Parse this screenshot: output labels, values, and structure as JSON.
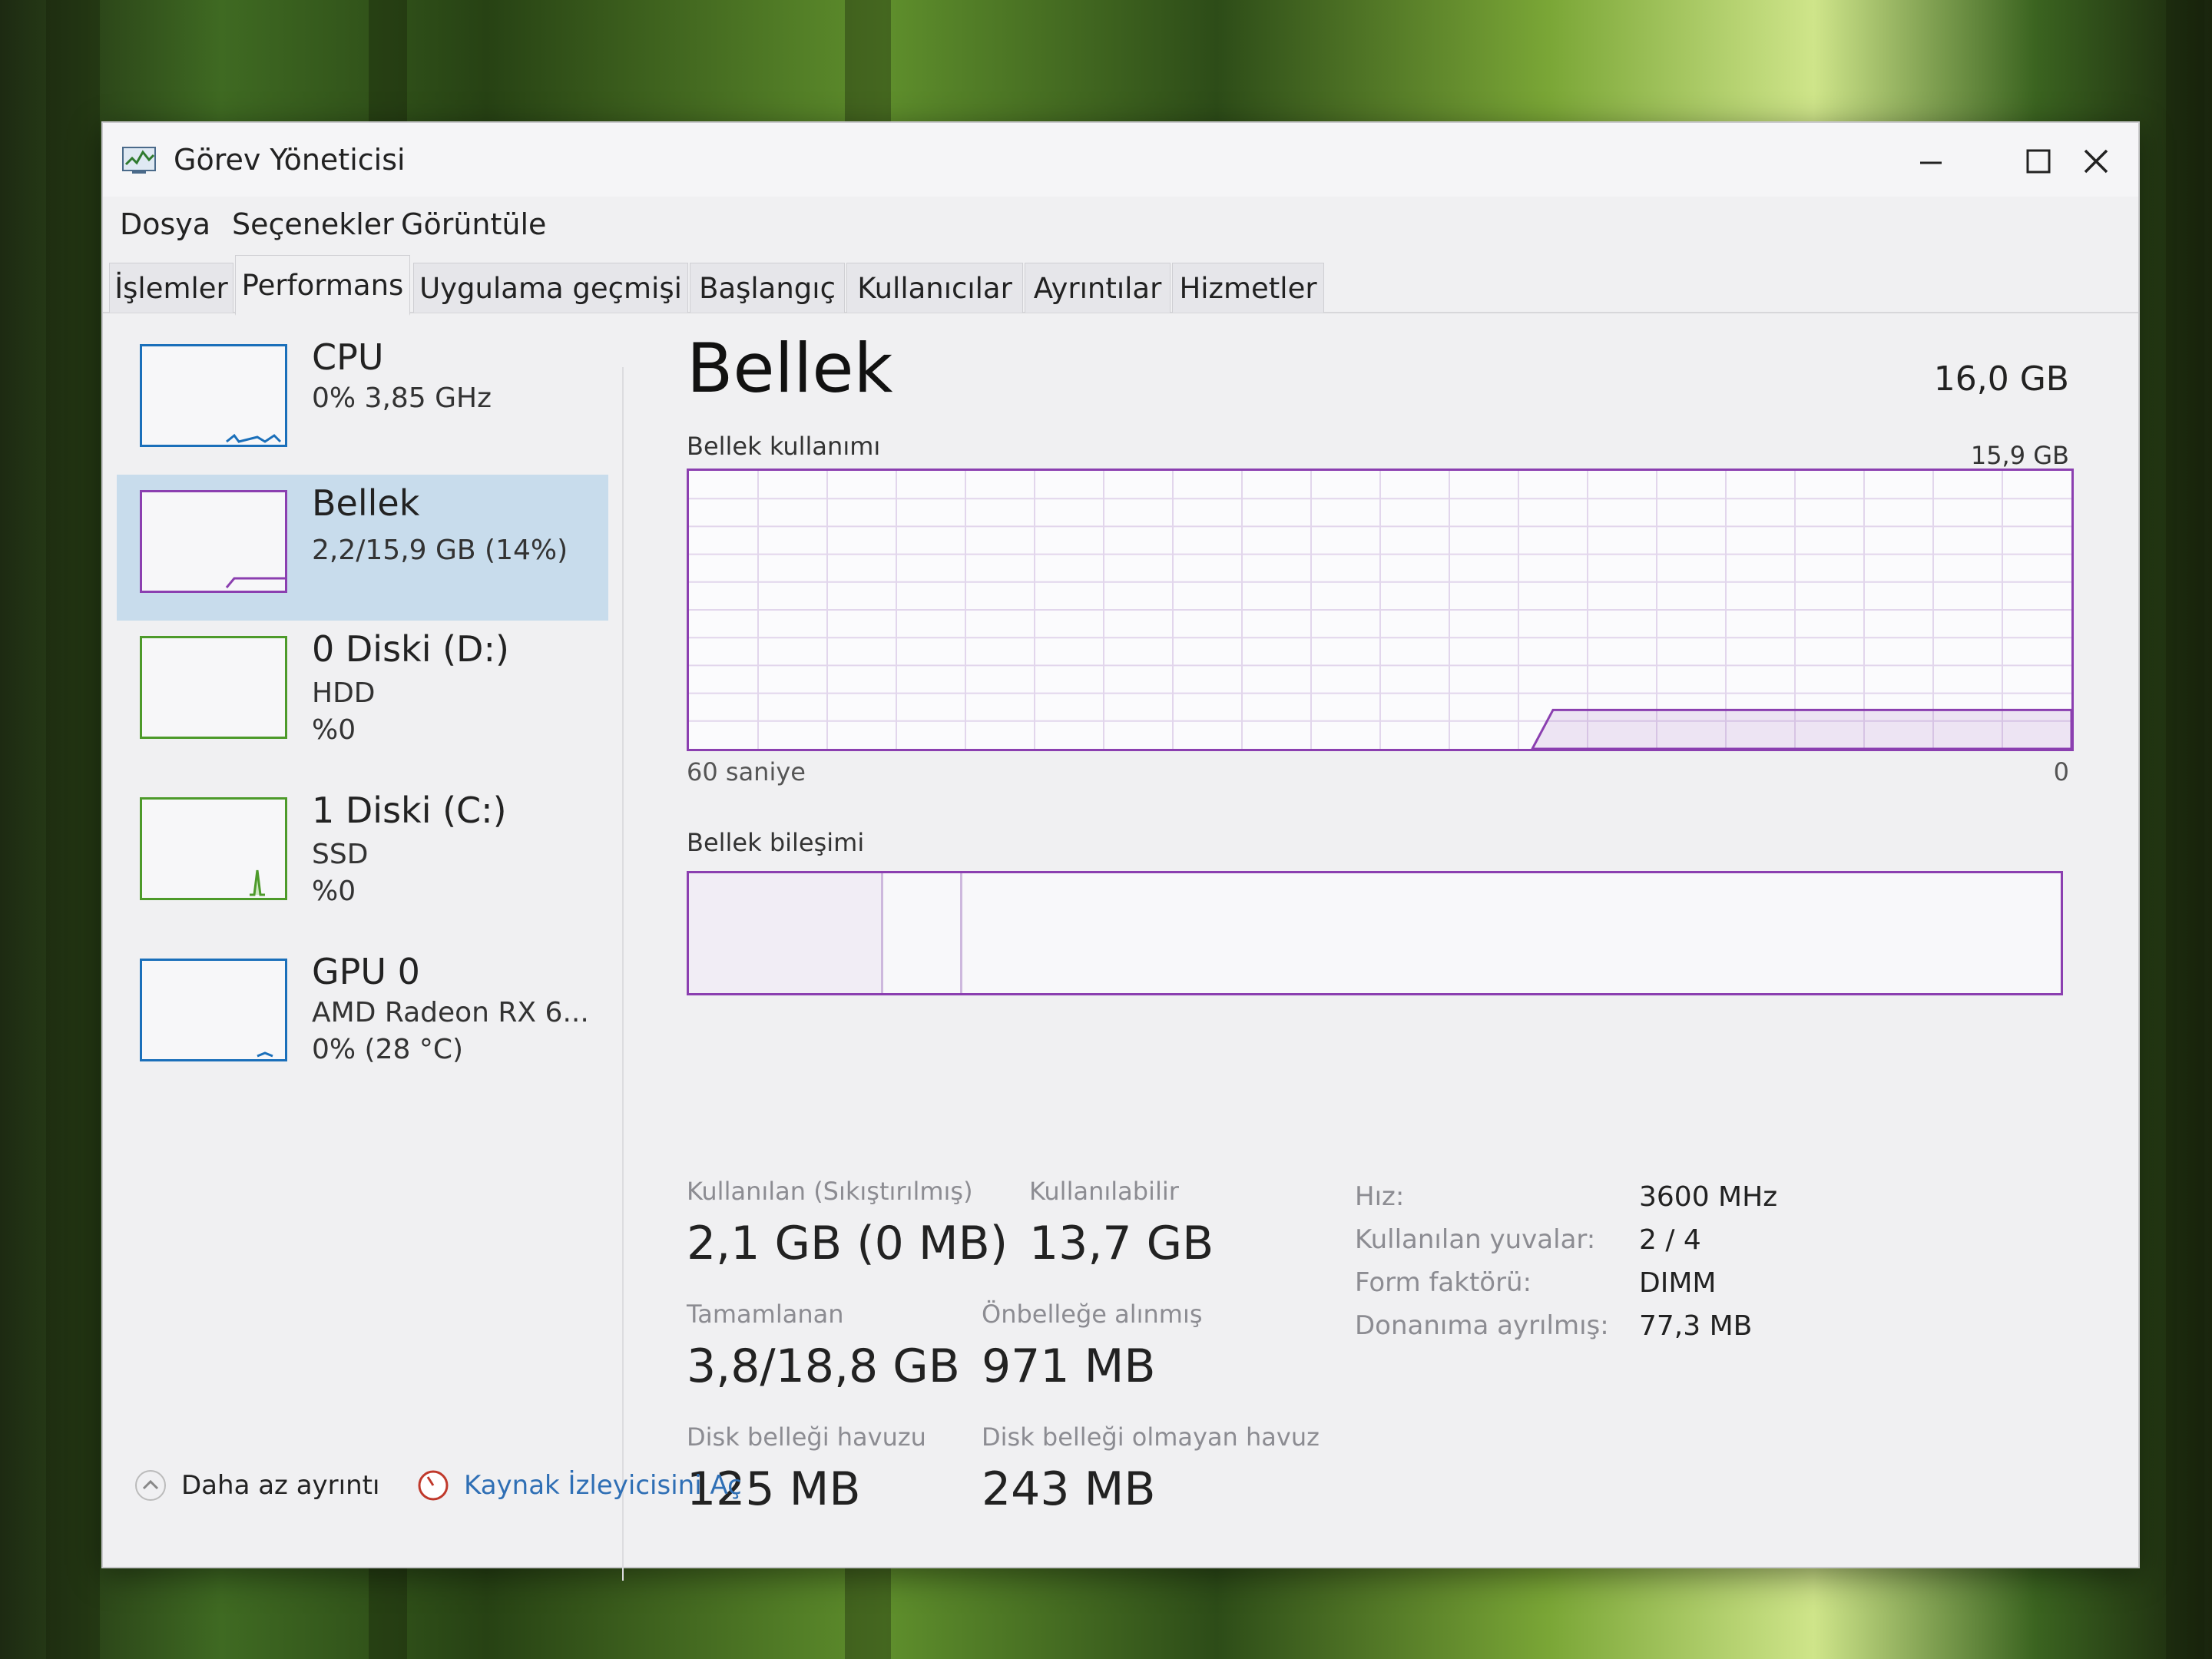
{
  "window": {
    "title": "Görev Yöneticisi"
  },
  "menu": [
    "Dosya",
    "Seçenekler",
    "Görüntüle"
  ],
  "tabs": [
    "İşlemler",
    "Performans",
    "Uygulama geçmişi",
    "Başlangıç",
    "Kullanıcılar",
    "Ayrıntılar",
    "Hizmetler"
  ],
  "active_tab": "Performans",
  "sidebar": {
    "items": [
      {
        "name": "CPU",
        "line1": "0% 3,85 GHz",
        "line2": "",
        "color": "#1a6fba"
      },
      {
        "name": "Bellek",
        "line1": "2,2/15,9 GB (14%)",
        "line2": "",
        "color": "#8b3fb0",
        "selected": true
      },
      {
        "name": "0 Diski (D:)",
        "line1": "HDD",
        "line2": "%0",
        "color": "#4d9a2a"
      },
      {
        "name": "1 Diski (C:)",
        "line1": "SSD",
        "line2": "%0",
        "color": "#4d9a2a"
      },
      {
        "name": "GPU 0",
        "line1": "AMD Radeon RX 6...",
        "line2": "0% (28 °C)",
        "color": "#1a6fba"
      }
    ]
  },
  "main": {
    "title": "Bellek",
    "total": "16,0 GB",
    "usage_label": "Bellek kullanımı",
    "usage_max": "15,9 GB",
    "time_label": "60 saniye",
    "time_min": "0",
    "composition_label": "Bellek bileşimi",
    "usage_fraction": 0.14
  },
  "stats": {
    "used_label": "Kullanılan (Sıkıştırılmış)",
    "used_value": "2,1 GB (0 MB)",
    "available_label": "Kullanılabilir",
    "available_value": "13,7 GB",
    "committed_label": "Tamamlanan",
    "committed_value": "3,8/18,8 GB",
    "cached_label": "Önbelleğe alınmış",
    "cached_value": "971 MB",
    "paged_label": "Disk belleği havuzu",
    "paged_value": "125 MB",
    "nonpaged_label": "Disk belleği olmayan havuz",
    "nonpaged_value": "243 MB"
  },
  "specs": {
    "speed_label": "Hız:",
    "speed_value": "3600 MHz",
    "slots_label": "Kullanılan yuvalar:",
    "slots_value": "2 / 4",
    "form_label": "Form faktörü:",
    "form_value": "DIMM",
    "reserved_label": "Donanıma ayrılmış:",
    "reserved_value": "77,3 MB"
  },
  "footer": {
    "fewer_details": "Daha az ayrıntı",
    "open_monitor": "Kaynak İzleyicisini Aç"
  },
  "colors": {
    "memory_accent": "#8b3fb0",
    "selection": "#c8dcec",
    "link": "#2f6fb5"
  }
}
